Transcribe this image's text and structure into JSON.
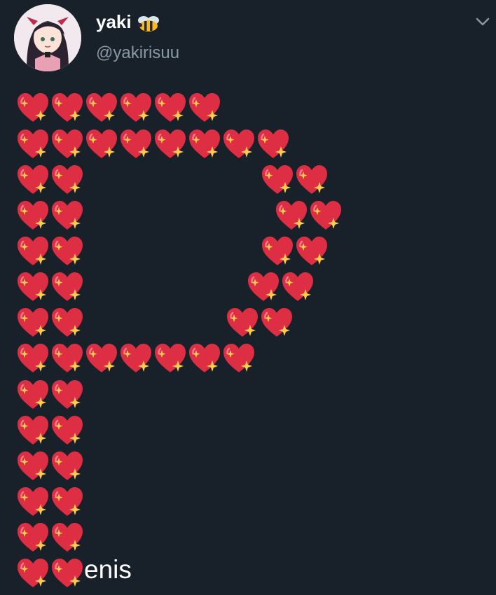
{
  "tweet": {
    "author": {
      "display_name": "yaki",
      "badge_icon": "bee-icon",
      "handle": "@yakirisuu",
      "avatar_icon": "avatar-anime-girl"
    },
    "menu_icon": "chevron-down-icon",
    "body": {
      "emoji": "sparkling-heart",
      "rows": [
        6,
        8,
        4,
        4,
        4,
        4,
        4,
        7,
        2,
        2,
        2,
        2,
        2,
        2
      ],
      "tail_text": "enis"
    }
  },
  "colors": {
    "background": "#18202a",
    "primary_text": "#ffffff",
    "secondary_text": "#8899a6",
    "heart": "#dd2e44",
    "sparkle": "#ffcc4d"
  }
}
